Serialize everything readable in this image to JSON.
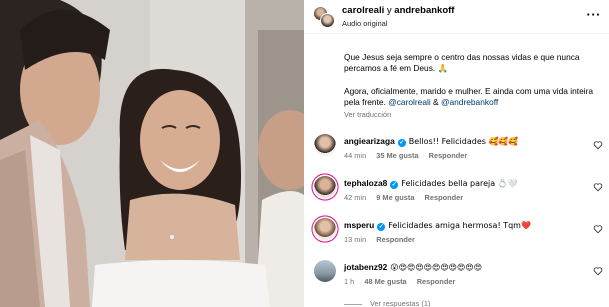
{
  "header": {
    "user1": "carolreali",
    "conj": "y",
    "user2": "andrebankoff",
    "audio": "Audio original",
    "more_icon": "more-horizontal-icon"
  },
  "caption": {
    "line1": "Que Jesus seja sempre o centro das nossas vidas e que nunca percamos a fé em Deus. 🙏",
    "line2_prefix": "Agora, oficialmente, marido e mulher. E ainda com uma vida inteira pela frente.",
    "tag1": "@carolreali",
    "amp": "&",
    "tag2": "@andrebankoff",
    "translate": "Ver traducción"
  },
  "comments": [
    {
      "user": "angiearizaga",
      "text": "Bellos!! Felicidades 🥰🥰🥰",
      "time": "44 min",
      "likes": "35 Me gusta",
      "reply": "Responder"
    },
    {
      "user": "tephaloza8",
      "text": "Felicidades bella pareja 💍🤍",
      "time": "42 min",
      "likes": "9 Me gusta",
      "reply": "Responder"
    },
    {
      "user": "msperu",
      "text": "Felicidades amiga hermosa! Tqm❤️",
      "time": "13 min",
      "likes": "",
      "reply": "Responder"
    },
    {
      "user": "jotabenz92",
      "text": "😮😍😍😍😍😍😍😍😍😍😍",
      "time": "1 h",
      "likes": "48 Me gusta",
      "reply": "Responder"
    }
  ],
  "replies_label": "Ver respuestas (1)",
  "colors": {
    "link": "#00376b",
    "meta": "#737373",
    "verified": "#0095f6"
  }
}
